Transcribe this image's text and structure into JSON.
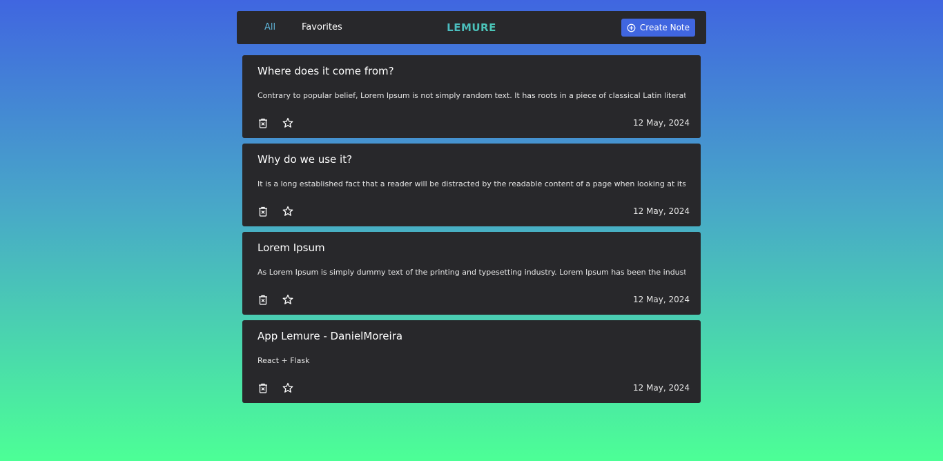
{
  "nav": {
    "tabs": [
      {
        "label": "All",
        "active": true
      },
      {
        "label": "Favorites",
        "active": false
      }
    ],
    "brand": "LEMURE",
    "create_label": "Create Note",
    "create_icon": "plus-circle-icon"
  },
  "colors": {
    "background_top": "#4066e0",
    "background_bottom": "#4cff96",
    "panel": "#28282b",
    "accent": "#4066e0",
    "active_tab": "#5fb3d6"
  },
  "notes": [
    {
      "title": "Where does it come from?",
      "body": "Contrary to popular belief, Lorem Ipsum is not simply random text. It has roots in a piece of classical Latin literature fro...",
      "date": "12 May, 2024",
      "favorite": false
    },
    {
      "title": "Why do we use it?",
      "body": "It is a long established fact that a reader will be distracted by the readable content of a page when looking at its layout. ...",
      "date": "12 May, 2024",
      "favorite": false
    },
    {
      "title": "Lorem Ipsum",
      "body": "As Lorem Ipsum is simply dummy text of the printing and typesetting industry. Lorem Ipsum has been the industry's ...",
      "date": "12 May, 2024",
      "favorite": false
    },
    {
      "title": "App Lemure - DanielMoreira",
      "body": "React + Flask",
      "date": "12 May, 2024",
      "favorite": false
    }
  ],
  "icons": {
    "delete": "trash-icon",
    "favorite": "star-icon"
  }
}
